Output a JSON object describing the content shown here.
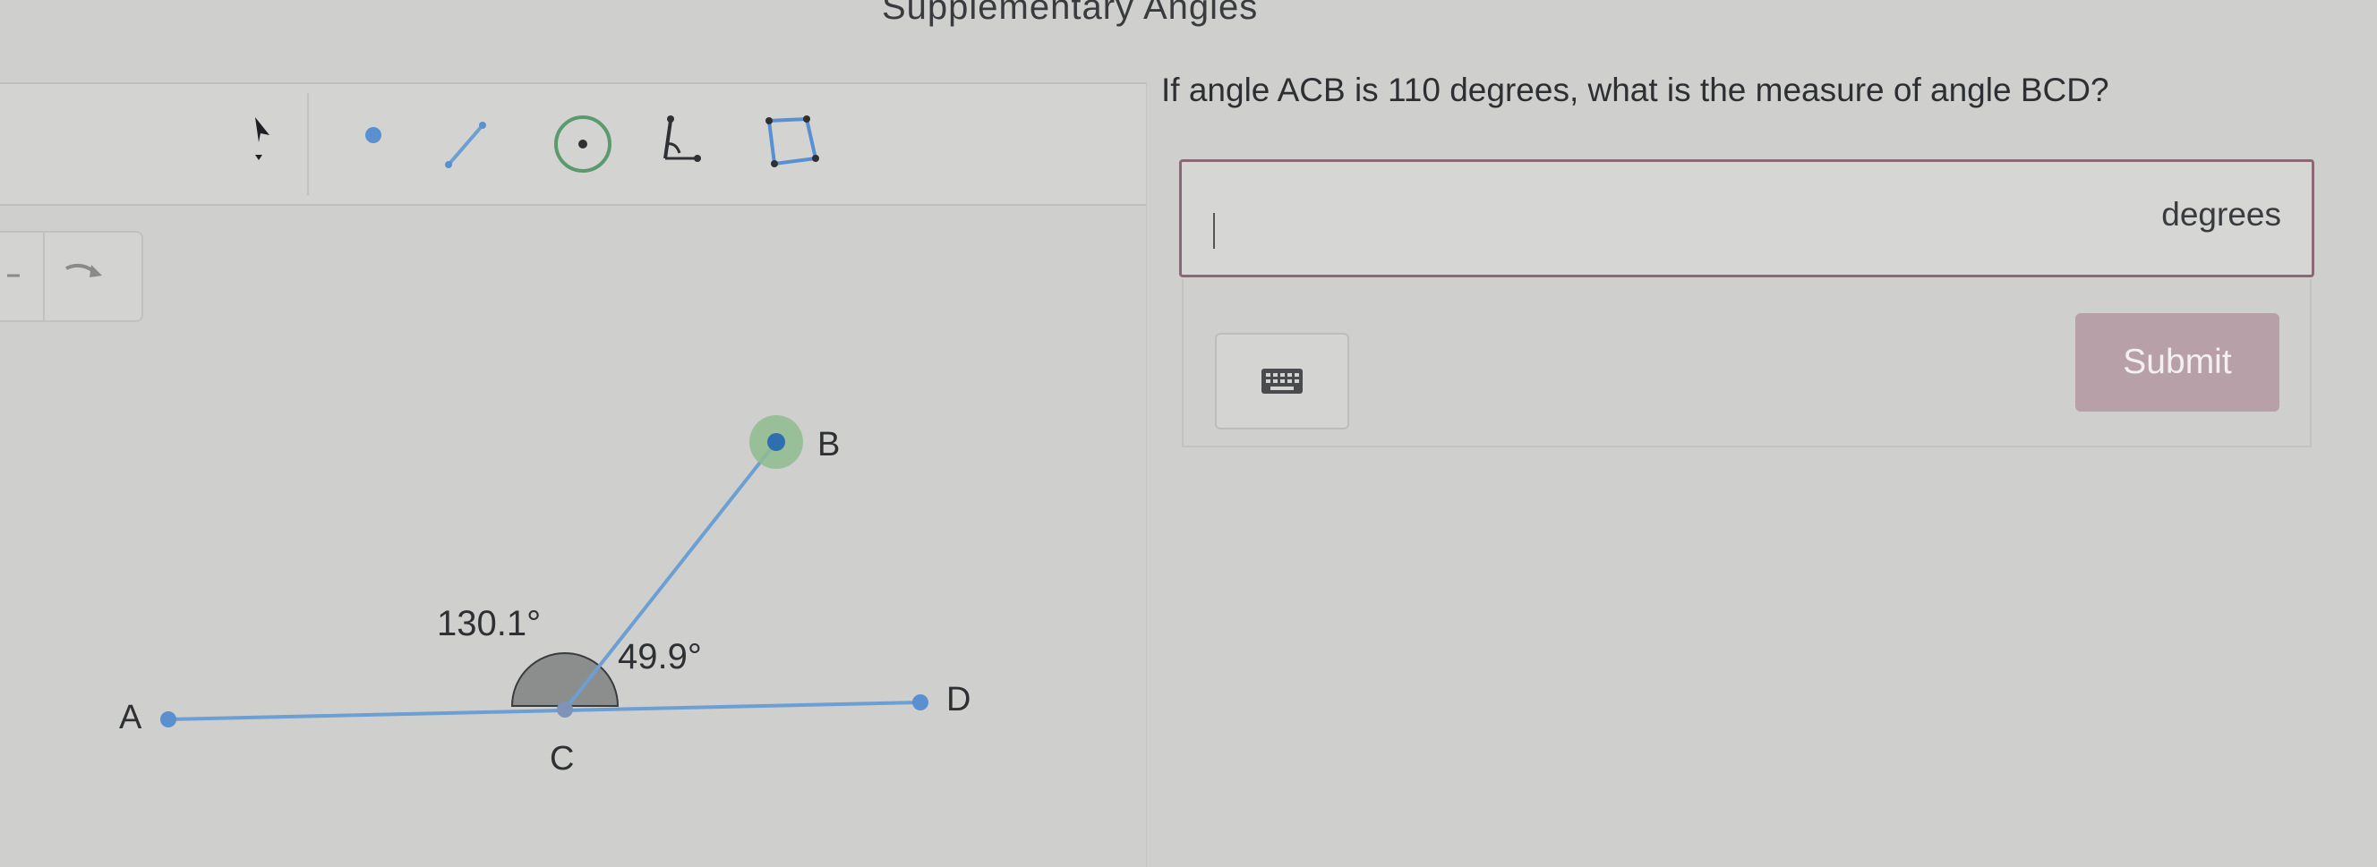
{
  "page": {
    "title": "Supplementary Angles"
  },
  "toolbar": {
    "tools": [
      {
        "icon": "pointer-arrow-icon"
      },
      {
        "icon": "point-icon"
      },
      {
        "icon": "segment-icon"
      },
      {
        "icon": "circle-icon"
      },
      {
        "icon": "angle-icon"
      },
      {
        "icon": "polygon-icon"
      }
    ],
    "undo_icon": "undo-icon",
    "redo_icon": "redo-icon"
  },
  "diagram": {
    "points": {
      "a": "A",
      "b": "B",
      "c": "C",
      "d": "D"
    },
    "angle_acb_label": "130.1°",
    "angle_bcd_label": "49.9°"
  },
  "question": {
    "text": "If angle ACB is 110 degrees, what is the measure of angle BCD?",
    "answer_value": "",
    "unit": "degrees",
    "submit_label": "Submit",
    "keyboard_icon": "keyboard-icon"
  },
  "colors": {
    "segment": "#6c9fd3",
    "highlight_point": "#8fbc8f",
    "point": "#5a8fd0",
    "angle_fill": "#8c8d8d",
    "answer_border": "#8b6878",
    "submit_bg": "#b7a0a8"
  }
}
